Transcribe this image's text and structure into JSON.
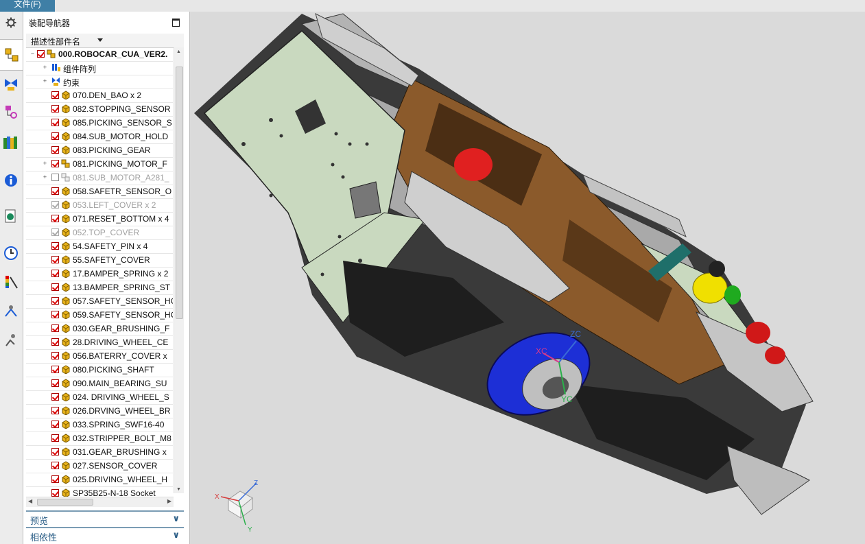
{
  "menu": {
    "file_label": "文件(F)"
  },
  "navigator": {
    "title": "装配导航器",
    "column_header": "描述性部件名",
    "rows": [
      {
        "label": "000.ROBOCAR_CUA_VER2.",
        "state": "on",
        "expand": "-",
        "indent": 0,
        "icon": "assembly-icon",
        "style": "bold"
      },
      {
        "label": "组件阵列",
        "state": "none",
        "expand": "+",
        "indent": 1,
        "icon": "component-pattern-icon",
        "style": "normal"
      },
      {
        "label": "约束",
        "state": "none",
        "expand": "+",
        "indent": 1,
        "icon": "constraint-icon",
        "style": "normal"
      },
      {
        "label": "070.DEN_BAO x 2",
        "state": "on",
        "expand": "",
        "indent": 1,
        "icon": "part-icon",
        "style": "normal"
      },
      {
        "label": "082.STOPPING_SENSOR",
        "state": "on",
        "expand": "",
        "indent": 1,
        "icon": "part-icon",
        "style": "normal"
      },
      {
        "label": "085.PICKING_SENSOR_S",
        "state": "on",
        "expand": "",
        "indent": 1,
        "icon": "part-icon",
        "style": "normal"
      },
      {
        "label": "084.SUB_MOTOR_HOLD",
        "state": "on",
        "expand": "",
        "indent": 1,
        "icon": "part-icon",
        "style": "normal"
      },
      {
        "label": "083.PICKING_GEAR",
        "state": "on",
        "expand": "",
        "indent": 1,
        "icon": "part-icon",
        "style": "normal"
      },
      {
        "label": "081.PICKING_MOTOR_F",
        "state": "on",
        "expand": "+",
        "indent": 1,
        "icon": "assembly-icon",
        "style": "normal"
      },
      {
        "label": "081.SUB_MOTOR_A281_",
        "state": "off",
        "expand": "+",
        "indent": 1,
        "icon": "assembly-ghost-icon",
        "style": "grey"
      },
      {
        "label": "058.SAFETR_SENSOR_O",
        "state": "on",
        "expand": "",
        "indent": 1,
        "icon": "part-icon",
        "style": "normal"
      },
      {
        "label": "053.LEFT_COVER x 2",
        "state": "dim",
        "expand": "",
        "indent": 1,
        "icon": "part-icon",
        "style": "grey"
      },
      {
        "label": "071.RESET_BOTTOM x 4",
        "state": "on",
        "expand": "",
        "indent": 1,
        "icon": "part-icon",
        "style": "normal"
      },
      {
        "label": "052.TOP_COVER",
        "state": "dim",
        "expand": "",
        "indent": 1,
        "icon": "part-icon",
        "style": "grey"
      },
      {
        "label": "54.SAFETY_PIN x 4",
        "state": "on",
        "expand": "",
        "indent": 1,
        "icon": "part-icon",
        "style": "normal"
      },
      {
        "label": "55.SAFETY_COVER",
        "state": "on",
        "expand": "",
        "indent": 1,
        "icon": "part-icon",
        "style": "normal"
      },
      {
        "label": "17.BAMPER_SPRING x 2",
        "state": "on",
        "expand": "",
        "indent": 1,
        "icon": "part-icon",
        "style": "normal"
      },
      {
        "label": "13.BAMPER_SPRING_ST",
        "state": "on",
        "expand": "",
        "indent": 1,
        "icon": "part-icon",
        "style": "normal"
      },
      {
        "label": "057.SAFETY_SENSOR_HO",
        "state": "on",
        "expand": "",
        "indent": 1,
        "icon": "part-icon",
        "style": "normal"
      },
      {
        "label": "059.SAFETY_SENSOR_HO",
        "state": "on",
        "expand": "",
        "indent": 1,
        "icon": "part-icon",
        "style": "normal"
      },
      {
        "label": "030.GEAR_BRUSHING_F",
        "state": "on",
        "expand": "",
        "indent": 1,
        "icon": "part-icon",
        "style": "normal"
      },
      {
        "label": "28.DRIVING_WHEEL_CE",
        "state": "on",
        "expand": "",
        "indent": 1,
        "icon": "part-icon",
        "style": "normal"
      },
      {
        "label": "056.BATERRY_COVER x",
        "state": "on",
        "expand": "",
        "indent": 1,
        "icon": "part-icon",
        "style": "normal"
      },
      {
        "label": "080.PICKING_SHAFT",
        "state": "on",
        "expand": "",
        "indent": 1,
        "icon": "part-icon",
        "style": "normal"
      },
      {
        "label": "090.MAIN_BEARING_SU",
        "state": "on",
        "expand": "",
        "indent": 1,
        "icon": "part-icon",
        "style": "normal"
      },
      {
        "label": "024. DRIVING_WHEEL_S",
        "state": "on",
        "expand": "",
        "indent": 1,
        "icon": "part-icon",
        "style": "normal"
      },
      {
        "label": "026.DRVING_WHEEL_BR",
        "state": "on",
        "expand": "",
        "indent": 1,
        "icon": "part-icon",
        "style": "normal"
      },
      {
        "label": "033.SPRING_SWF16-40",
        "state": "on",
        "expand": "",
        "indent": 1,
        "icon": "part-icon",
        "style": "normal"
      },
      {
        "label": "032.STRIPPER_BOLT_M8",
        "state": "on",
        "expand": "",
        "indent": 1,
        "icon": "part-icon",
        "style": "normal"
      },
      {
        "label": "031.GEAR_BRUSHING x",
        "state": "on",
        "expand": "",
        "indent": 1,
        "icon": "part-icon",
        "style": "normal"
      },
      {
        "label": "027.SENSOR_COVER",
        "state": "on",
        "expand": "",
        "indent": 1,
        "icon": "part-icon",
        "style": "normal"
      },
      {
        "label": "025.DRIVING_WHEEL_H",
        "state": "on",
        "expand": "",
        "indent": 1,
        "icon": "part-icon",
        "style": "normal"
      },
      {
        "label": "SP35B25-N-18 Socket",
        "state": "on",
        "expand": "",
        "indent": 1,
        "icon": "part-icon",
        "style": "normal"
      }
    ],
    "panels": [
      {
        "label": "预览",
        "name": "preview-panel"
      },
      {
        "label": "相依性",
        "name": "dependencies-panel"
      }
    ]
  },
  "resource_bar": [
    "gear-icon",
    "assembly-navigator-icon",
    "constraint-navigator-icon",
    "part-navigator-icon",
    "reuse-library-icon",
    "info-icon",
    "web-browser-icon",
    "history-icon",
    "visualization-icon",
    "process-studio-icon",
    "roles-icon"
  ],
  "viewport": {
    "csys_labels": {
      "xc": "XC",
      "yc": "YC",
      "zc": "ZC"
    },
    "triad_labels": {
      "x": "X",
      "y": "Y",
      "z": "Z"
    },
    "colors": {
      "green_plate": "#c9d9bf",
      "brown": "#8b5a2b",
      "grey_steel": "#b9b9b9",
      "dark": "#2a2a2a",
      "blue_wheel": "#1d2fd6",
      "red": "#e02020",
      "yellow": "#f0e000",
      "teal": "#1f6f6a",
      "green_knob": "#1faa1f"
    }
  }
}
